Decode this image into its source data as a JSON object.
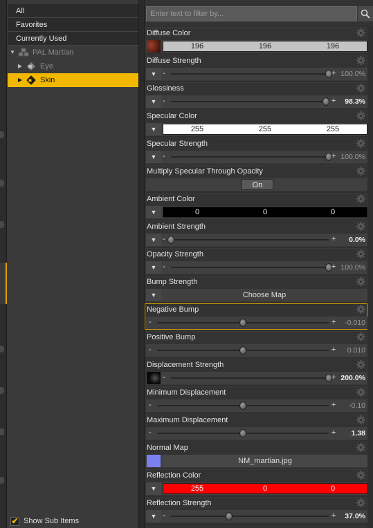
{
  "tree": {
    "top_items": [
      "All",
      "Favorites",
      "Currently Used"
    ],
    "nodes": [
      {
        "label": "PAL Martian",
        "dim": true
      },
      {
        "label": "Eye",
        "dim": true
      },
      {
        "label": "Skin",
        "dim": false
      }
    ],
    "show_sub_items": "Show Sub Items"
  },
  "filter": {
    "placeholder": "Enter text to filter by..."
  },
  "properties": {
    "diffuse_color": {
      "label": "Diffuse Color",
      "r": "196",
      "g": "196",
      "b": "196",
      "color": "#c4c4c4"
    },
    "diffuse_strength": {
      "label": "Diffuse Strength",
      "value": "100.0%",
      "fraction": 1.0
    },
    "glossiness": {
      "label": "Glossiness",
      "value": "98.3%",
      "fraction": 0.983
    },
    "specular_color": {
      "label": "Specular Color",
      "r": "255",
      "g": "255",
      "b": "255",
      "color": "#ffffff"
    },
    "specular_strength": {
      "label": "Specular Strength",
      "value": "100.0%",
      "fraction": 1.0
    },
    "multiply_specular": {
      "label": "Multiply Specular Through Opacity",
      "toggle": "On"
    },
    "ambient_color": {
      "label": "Ambient Color",
      "r": "0",
      "g": "0",
      "b": "0",
      "color": "#000000"
    },
    "ambient_strength": {
      "label": "Ambient Strength",
      "value": "0.0%",
      "fraction": 0.0
    },
    "opacity_strength": {
      "label": "Opacity Strength",
      "value": "100.0%",
      "fraction": 1.0
    },
    "bump_strength": {
      "label": "Bump Strength",
      "choose": "Choose Map"
    },
    "negative_bump": {
      "label": "Negative Bump",
      "value": "-0.010",
      "fraction": 0.5
    },
    "positive_bump": {
      "label": "Positive Bump",
      "value": "0.010",
      "fraction": 0.5
    },
    "displacement_strength": {
      "label": "Displacement Strength",
      "value": "200.0%",
      "fraction": 1.0
    },
    "minimum_displacement": {
      "label": "Minimum Displacement",
      "value": "-0.10",
      "fraction": 0.5
    },
    "maximum_displacement": {
      "label": "Maximum Displacement",
      "value": "1.38",
      "fraction": 0.5
    },
    "normal_map": {
      "label": "Normal Map",
      "file": "NM_martian.jpg"
    },
    "reflection_color": {
      "label": "Reflection Color",
      "r": "255",
      "g": "0",
      "b": "0",
      "color": "#ff0000"
    },
    "reflection_strength": {
      "label": "Reflection Strength",
      "value": "37.0%",
      "fraction": 0.37
    }
  },
  "accent": "#f2b800"
}
